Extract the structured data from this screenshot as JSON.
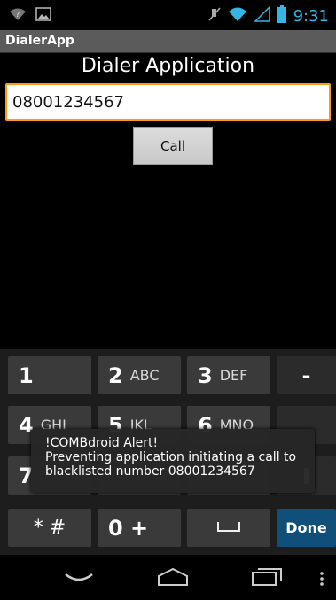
{
  "status_bar": {
    "time": "9:31",
    "icons": [
      "wifi-question-icon",
      "image-notification-icon",
      "mute-icon",
      "wifi-icon",
      "signal-icon",
      "battery-icon"
    ]
  },
  "app": {
    "title": "DialerApp",
    "heading": "Dialer Application",
    "number_value": "08001234567",
    "call_label": "Call"
  },
  "keypad": {
    "row1": [
      {
        "num": "1",
        "letters": ""
      },
      {
        "num": "2",
        "letters": "ABC"
      },
      {
        "num": "3",
        "letters": "DEF"
      },
      {
        "num": "-",
        "letters": ""
      }
    ],
    "row2": [
      {
        "num": "4",
        "letters": "GHI"
      },
      {
        "num": "5",
        "letters": "JKL"
      },
      {
        "num": "6",
        "letters": "MNO"
      }
    ],
    "row3": [
      {
        "num": "7",
        "letters": ""
      }
    ],
    "row4": {
      "star_hash": "* #",
      "zero_plus": "0 +",
      "done": "Done"
    }
  },
  "alert": {
    "title": "!COMBdroid Alert!",
    "message": "Preventing application initiating a call to blacklisted number 08001234567"
  },
  "colors": {
    "accent": "#33b5e5",
    "focus_border": "#ff9a1b",
    "done_key": "#0f4f79"
  }
}
